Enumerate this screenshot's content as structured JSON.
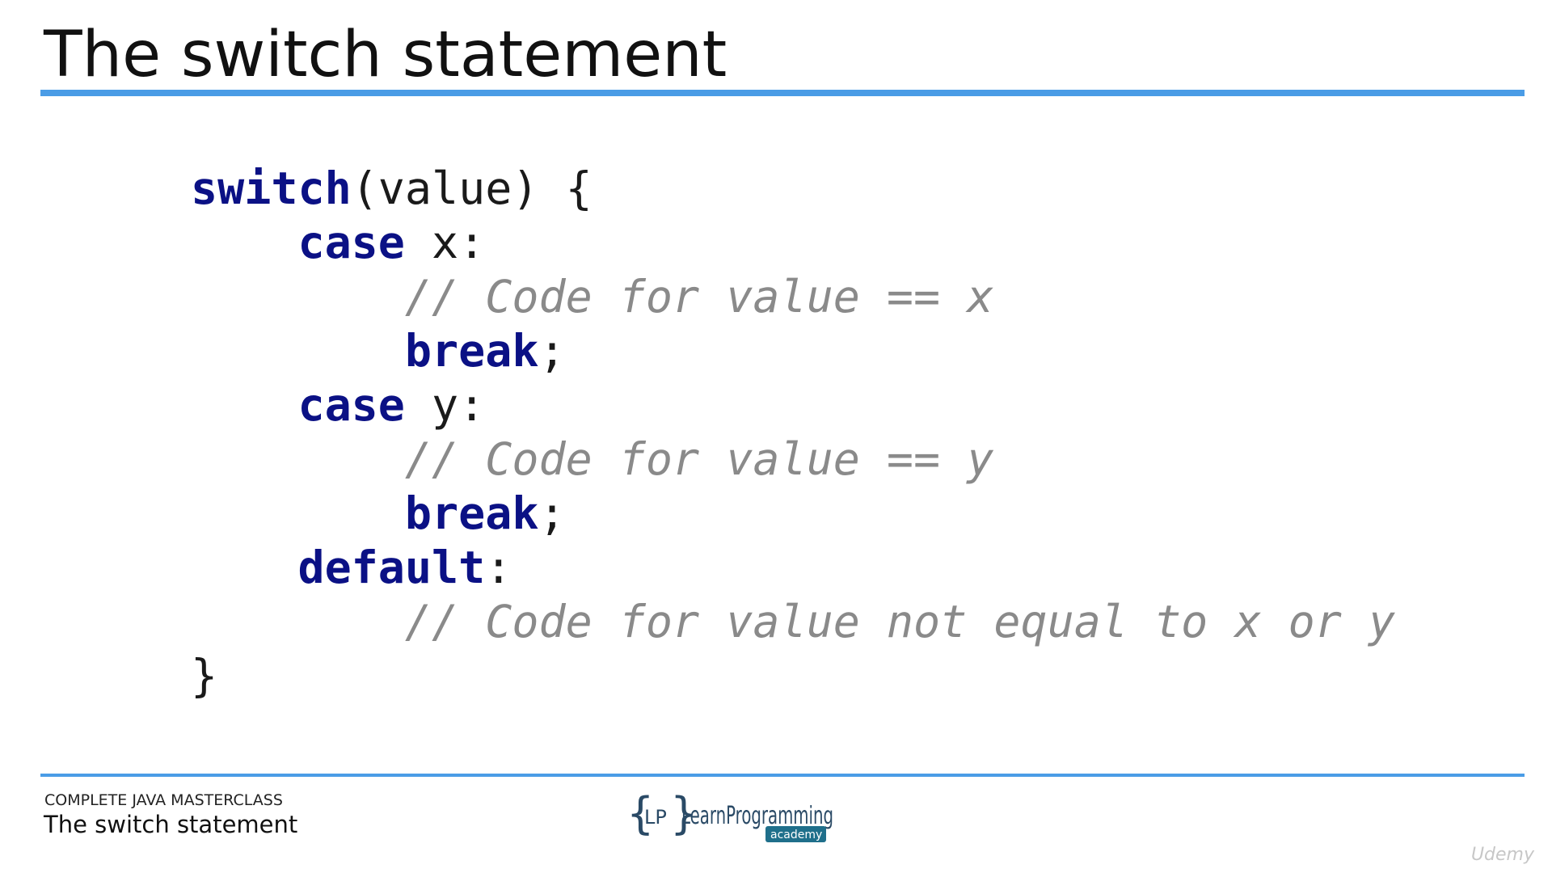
{
  "slide": {
    "title": "The switch statement"
  },
  "code": {
    "lines": [
      {
        "indent": "",
        "kw": "switch",
        "rest": "(value) {",
        "comment": ""
      },
      {
        "indent": "    ",
        "kw": "case",
        "rest": " x:",
        "comment": ""
      },
      {
        "indent": "        ",
        "kw": "",
        "rest": "",
        "comment": "// Code for value == x"
      },
      {
        "indent": "        ",
        "kw": "break",
        "rest": ";",
        "comment": ""
      },
      {
        "indent": "    ",
        "kw": "case",
        "rest": " y:",
        "comment": ""
      },
      {
        "indent": "        ",
        "kw": "",
        "rest": "",
        "comment": "// Code for value == y"
      },
      {
        "indent": "        ",
        "kw": "break",
        "rest": ";",
        "comment": ""
      },
      {
        "indent": "    ",
        "kw": "default",
        "rest": ":",
        "comment": ""
      },
      {
        "indent": "        ",
        "kw": "",
        "rest": "",
        "comment": "// Code for value not equal to x or y"
      },
      {
        "indent": "",
        "kw": "",
        "rest": "}",
        "comment": ""
      }
    ]
  },
  "footer": {
    "course_name": "COMPLETE JAVA MASTERCLASS",
    "lecture_title": "The switch statement",
    "logo_icon": "learnprogramming-academy-logo",
    "logo_text": "LearnProgramming",
    "logo_subtext": "academy",
    "watermark": "Udemy"
  },
  "colors": {
    "accent_rule": "#4a9ce6",
    "keyword": "#0b1185",
    "comment": "#8a8a8a",
    "logo_bracket": "#2a4a66",
    "logo_text": "#3fa9d6",
    "logo_badge": "#1f6f8b"
  }
}
